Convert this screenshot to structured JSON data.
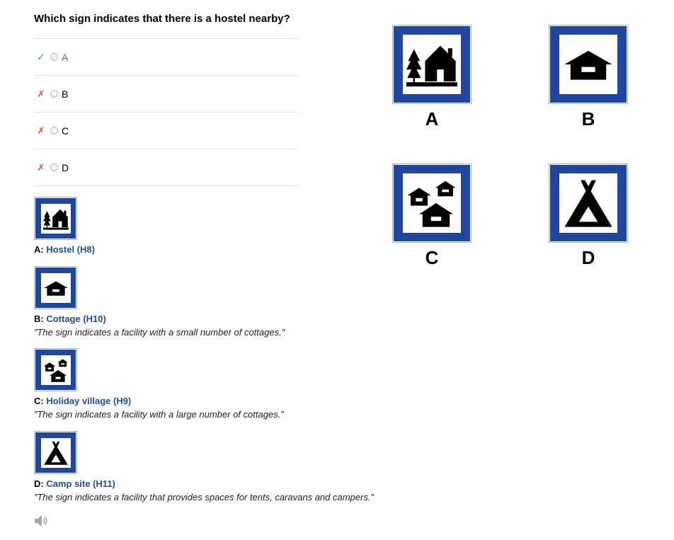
{
  "question": {
    "text": "Which sign indicates that there is a hostel nearby?"
  },
  "options": [
    {
      "letter": "A",
      "mark": "✓",
      "status": "correct"
    },
    {
      "letter": "B",
      "mark": "✗",
      "status": "incorrect"
    },
    {
      "letter": "C",
      "mark": "✗",
      "status": "incorrect"
    },
    {
      "letter": "D",
      "mark": "✗",
      "status": "incorrect"
    }
  ],
  "explanations": [
    {
      "letter": "A:",
      "name": "Hostel (H8)",
      "description": "",
      "icon": "hostel-sign-icon"
    },
    {
      "letter": "B:",
      "name": "Cottage (H10)",
      "description": "”The sign indicates a facility with a small number of cottages.”",
      "icon": "cottage-sign-icon"
    },
    {
      "letter": "C:",
      "name": "Holiday village (H9)",
      "description": "”The sign indicates a facility with a large number of cottages.”",
      "icon": "holiday-village-sign-icon"
    },
    {
      "letter": "D:",
      "name": "Camp site (H11)",
      "description": "”The sign indicates a facility that provides spaces for tents, caravans and campers.”",
      "icon": "camp-site-sign-icon"
    }
  ],
  "big_signs": [
    {
      "label": "A",
      "icon": "hostel-sign-icon"
    },
    {
      "label": "B",
      "icon": "cottage-sign-icon"
    },
    {
      "label": "C",
      "icon": "holiday-village-sign-icon"
    },
    {
      "label": "D",
      "icon": "camp-site-sign-icon"
    }
  ],
  "audio": {
    "icon": "speaker-icon"
  },
  "colors": {
    "sign_blue": "#1f47a1",
    "correct": "#2e9d2e",
    "incorrect": "#e05050",
    "link": "#1f4e9c"
  }
}
